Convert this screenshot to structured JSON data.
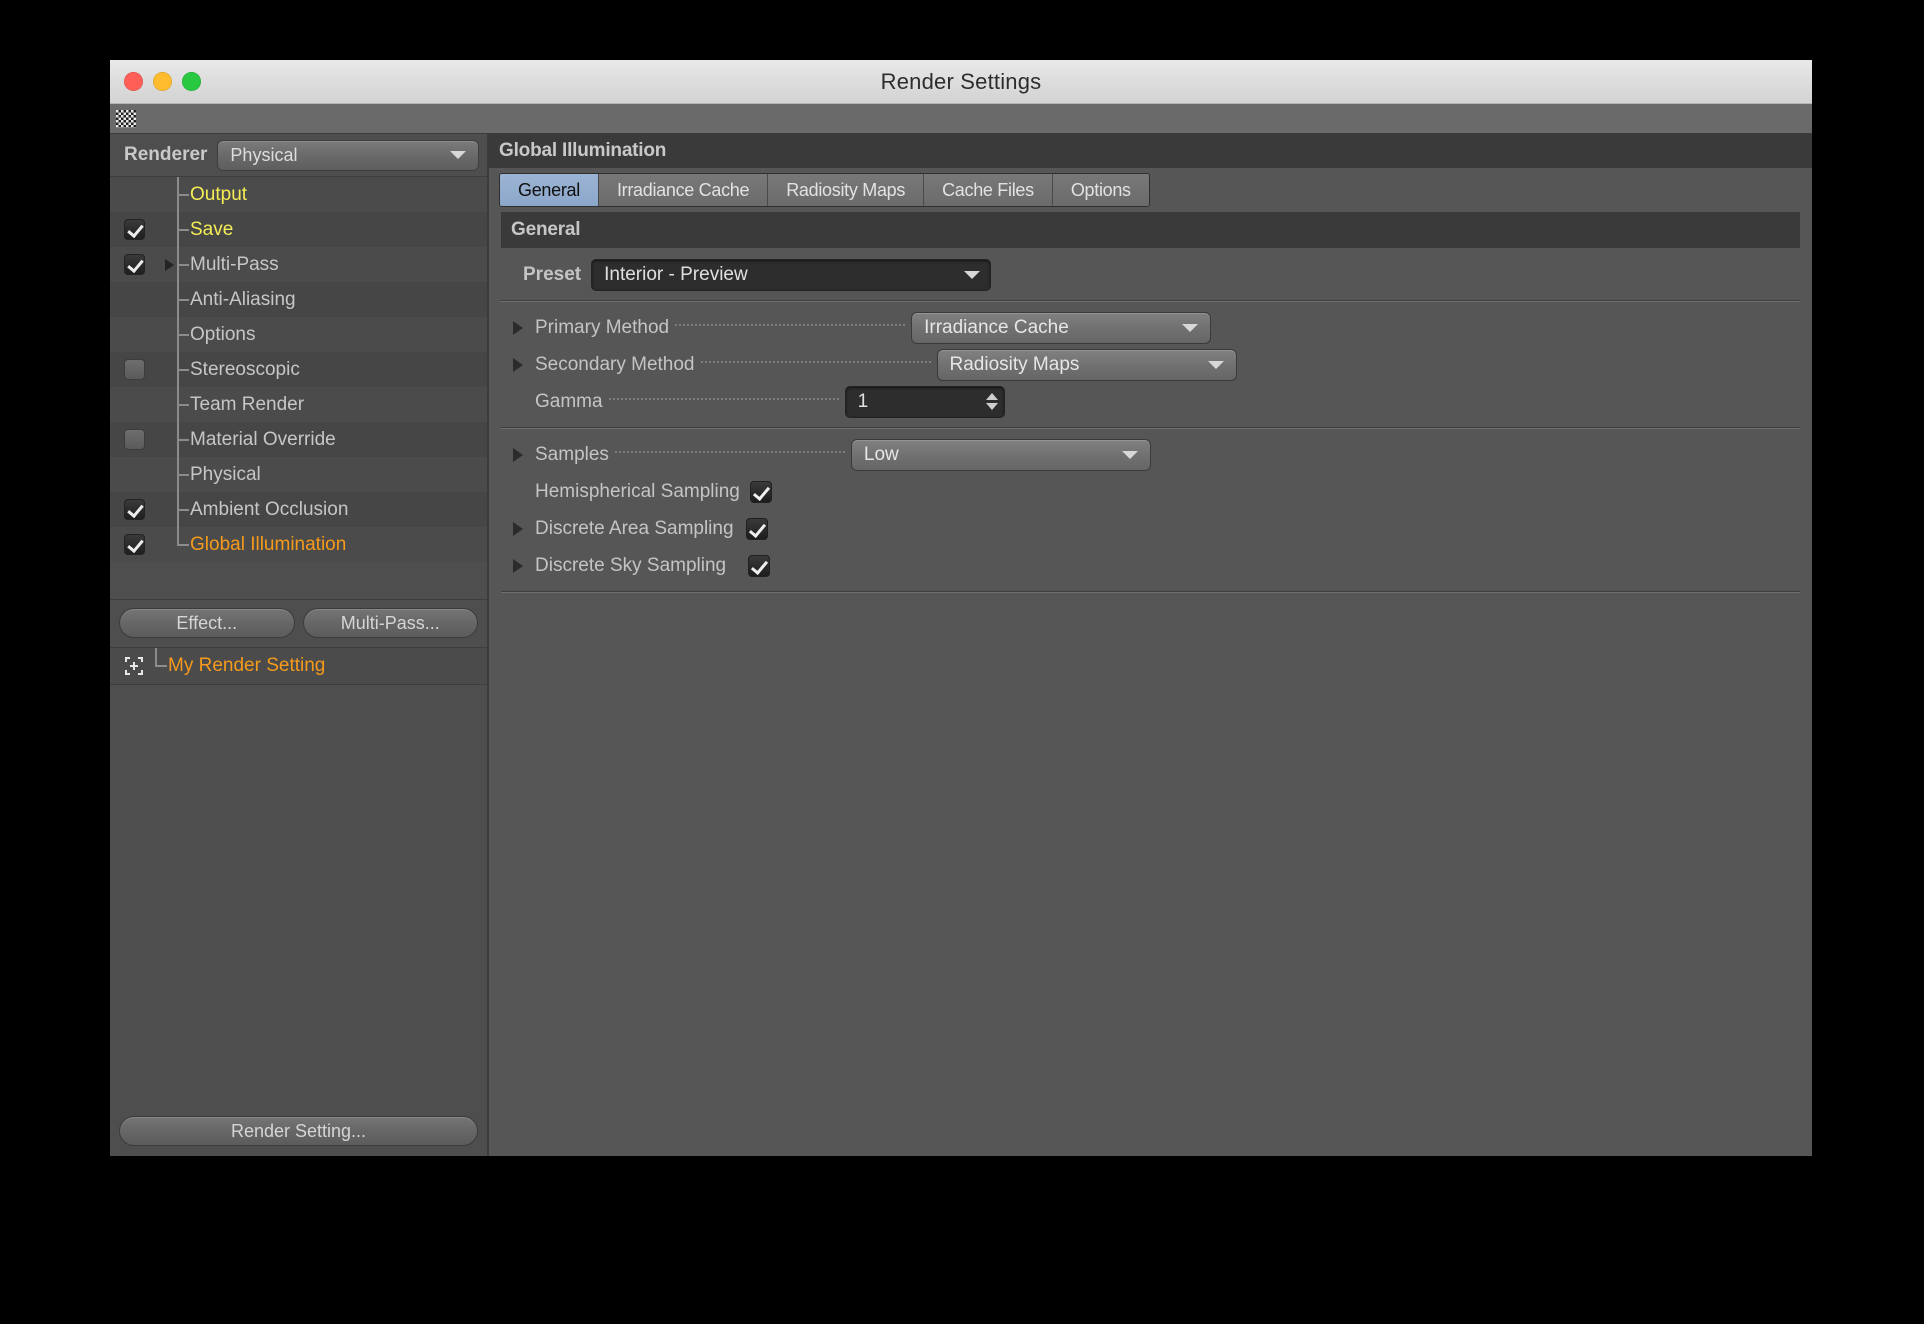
{
  "window": {
    "title": "Render Settings",
    "traffic_lights": [
      "close-button",
      "minimize-button",
      "zoom-button"
    ],
    "colors": {
      "close": "#FF5F57",
      "minimize": "#FEBC2E",
      "zoom": "#28C840",
      "accent_tab": "#8BA7CA",
      "selected_item": "#F59A1B",
      "yellow_item": "#F4ED55"
    }
  },
  "sidebar": {
    "renderer_label": "Renderer",
    "renderer_value": "Physical",
    "tree": [
      {
        "label": "Output",
        "color": "yellow",
        "checkbox": "none",
        "expandable": false
      },
      {
        "label": "Save",
        "color": "yellow",
        "checkbox": "checked",
        "expandable": false
      },
      {
        "label": "Multi-Pass",
        "color": "gray",
        "checkbox": "checked",
        "expandable": true
      },
      {
        "label": "Anti-Aliasing",
        "color": "gray",
        "checkbox": "none",
        "expandable": false
      },
      {
        "label": "Options",
        "color": "gray",
        "checkbox": "none",
        "expandable": false
      },
      {
        "label": "Stereoscopic",
        "color": "gray",
        "checkbox": "unchecked",
        "expandable": false
      },
      {
        "label": "Team Render",
        "color": "gray",
        "checkbox": "none",
        "expandable": false
      },
      {
        "label": "Material Override",
        "color": "gray",
        "checkbox": "unchecked",
        "expandable": false
      },
      {
        "label": "Physical",
        "color": "gray",
        "checkbox": "none",
        "expandable": false
      },
      {
        "label": "Ambient Occlusion",
        "color": "gray",
        "checkbox": "checked",
        "expandable": false
      },
      {
        "label": "Global Illumination",
        "color": "orange",
        "checkbox": "checked",
        "expandable": false
      }
    ],
    "buttons": {
      "effect": "Effect...",
      "multipass": "Multi-Pass..."
    },
    "saved_setting": {
      "label": "My Render Setting",
      "icon": "move-crosshair-icon"
    },
    "render_setting_button": "Render Setting..."
  },
  "panel": {
    "title": "Global Illumination",
    "tabs": [
      {
        "label": "General",
        "active": true
      },
      {
        "label": "Irradiance Cache",
        "active": false
      },
      {
        "label": "Radiosity Maps",
        "active": false
      },
      {
        "label": "Cache Files",
        "active": false
      },
      {
        "label": "Options",
        "active": false
      }
    ],
    "section_header": "General",
    "preset": {
      "label": "Preset",
      "value": "Interior - Preview"
    },
    "fields": [
      {
        "label": "Primary Method",
        "value": "Irradiance Cache",
        "kind": "combo",
        "expandable": true
      },
      {
        "label": "Secondary Method",
        "value": "Radiosity Maps",
        "kind": "combo",
        "expandable": true
      },
      {
        "label": "Gamma",
        "value": "1",
        "kind": "spinner",
        "expandable": false
      }
    ],
    "sampling": [
      {
        "label": "Samples",
        "value": "Low",
        "kind": "combo",
        "expandable": true
      },
      {
        "label": "Hemispherical Sampling",
        "value": "",
        "kind": "checkbox",
        "expandable": false,
        "checked": true
      },
      {
        "label": "Discrete Area Sampling",
        "value": "",
        "kind": "checkbox",
        "expandable": true,
        "checked": true
      },
      {
        "label": "Discrete Sky Sampling",
        "value": "",
        "kind": "checkbox",
        "expandable": true,
        "checked": true
      }
    ]
  }
}
